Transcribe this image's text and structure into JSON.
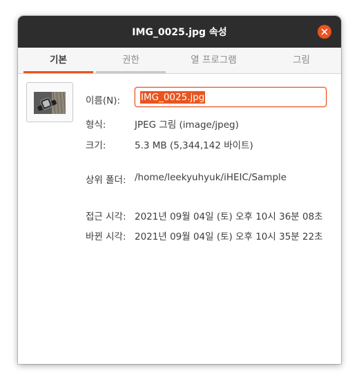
{
  "window": {
    "title": "IMG_0025.jpg 속성"
  },
  "tabs": [
    {
      "label": "기본"
    },
    {
      "label": "권한"
    },
    {
      "label": "열 프로그램"
    },
    {
      "label": "그림"
    }
  ],
  "basic": {
    "name_label": "이름(N):",
    "name_value": "IMG_0025.jpg",
    "type_label": "형식:",
    "type_value": "JPEG 그림 (image/jpeg)",
    "size_label": "크기:",
    "size_value": "5.3 MB (5,344,142 바이트)",
    "parent_label": "상위 폴더:",
    "parent_value": "/home/leekyuhyuk/iHEIC/Sample",
    "accessed_label": "접근 시각:",
    "accessed_value": "2021년 09월 04일 (토) 오후 10시 36분 08초",
    "modified_label": "바뀐 시각:",
    "modified_value": "2021년 09월 04일 (토) 오후 10시 35분 22초"
  },
  "colors": {
    "accent": "#e95420",
    "titlebar": "#2d2d2d"
  },
  "icons": {
    "close": "close-icon",
    "thumbnail": "image-thumbnail"
  }
}
